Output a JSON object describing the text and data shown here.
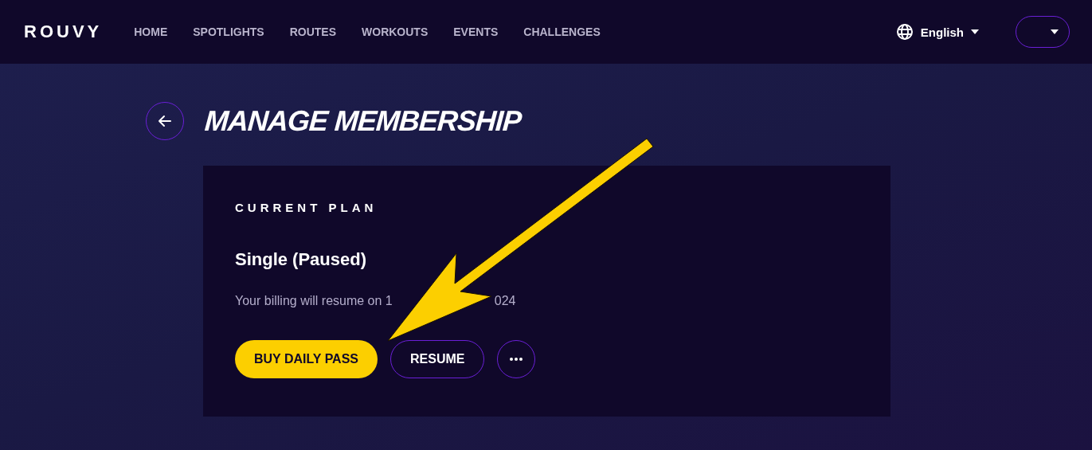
{
  "header": {
    "logo": "ROUVY",
    "nav": [
      {
        "label": "HOME"
      },
      {
        "label": "SPOTLIGHTS"
      },
      {
        "label": "ROUTES"
      },
      {
        "label": "WORKOUTS"
      },
      {
        "label": "EVENTS"
      },
      {
        "label": "CHALLENGES"
      }
    ],
    "language": "English"
  },
  "page": {
    "title": "MANAGE MEMBERSHIP"
  },
  "card": {
    "heading": "CURRENT PLAN",
    "plan": "Single (Paused)",
    "billing_before": "Your billing will resume on 1",
    "billing_after": "024",
    "buttons": [
      {
        "kind": "primary",
        "label": "BUY DAILY PASS"
      },
      {
        "kind": "outline",
        "label": "RESUME"
      },
      {
        "kind": "more"
      }
    ]
  }
}
